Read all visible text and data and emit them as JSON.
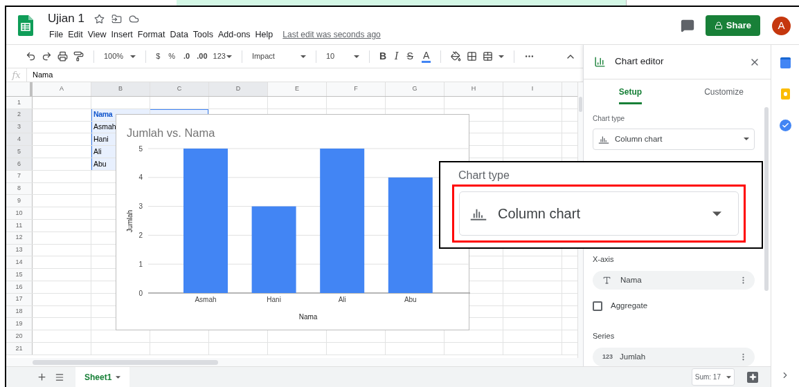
{
  "header": {
    "title": "Ujian 1",
    "menu": [
      "File",
      "Edit",
      "View",
      "Insert",
      "Format",
      "Data",
      "Tools",
      "Add-ons",
      "Help"
    ],
    "last_edit": "Last edit was seconds ago",
    "share": "Share",
    "avatar": "A"
  },
  "toolbar": {
    "zoom": "100%",
    "currency": "$",
    "percent": "%",
    "decrease_decimal": ".0",
    "increase_decimal": ".00",
    "number_format": "123",
    "font": "Impact",
    "font_size": "10",
    "bold": "B",
    "italic": "I",
    "strikethrough": "S",
    "text_color": "A"
  },
  "formula_bar": {
    "fx": "fx",
    "value": "Nama"
  },
  "grid": {
    "columns": [
      "A",
      "B",
      "C",
      "D",
      "E",
      "F",
      "G",
      "H",
      "I"
    ],
    "rows": [
      {
        "number": "1"
      },
      {
        "number": "2",
        "B": {
          "text": "Nama",
          "bold": true,
          "selected": true
        },
        "C": {
          "selected": true
        }
      },
      {
        "number": "3",
        "B": {
          "text": "Asmah",
          "bold": false,
          "selected": true
        }
      },
      {
        "number": "4",
        "B": {
          "text": "Hani",
          "bold": false,
          "selected": true
        }
      },
      {
        "number": "5",
        "B": {
          "text": "Ali",
          "bold": false,
          "selected": true
        }
      },
      {
        "number": "6",
        "B": {
          "text": "Abu",
          "bold": false,
          "selected": true
        }
      },
      {
        "number": "7"
      },
      {
        "number": "8"
      },
      {
        "number": "9"
      },
      {
        "number": "10"
      },
      {
        "number": "11"
      },
      {
        "number": "12"
      },
      {
        "number": "13"
      },
      {
        "number": "14"
      },
      {
        "number": "15"
      },
      {
        "number": "16"
      },
      {
        "number": "17"
      },
      {
        "number": "18"
      },
      {
        "number": "19"
      },
      {
        "number": "20"
      },
      {
        "number": "21"
      }
    ]
  },
  "chart": {
    "chart_data": {
      "type": "bar",
      "title": "Jumlah vs. Nama",
      "xlabel": "Nama",
      "ylabel": "Jumlah",
      "categories": [
        "Asmah",
        "Hani",
        "Ali",
        "Abu"
      ],
      "series": [
        {
          "color": "#4285f4",
          "values": [
            5,
            3,
            5,
            4
          ]
        }
      ],
      "ylim": [
        0,
        5
      ],
      "grid": true,
      "yticks": [
        {
          "value": 0,
          "label": "0"
        },
        {
          "value": 1,
          "label": "1"
        },
        {
          "value": 2,
          "label": "2"
        },
        {
          "value": 3,
          "label": "3"
        },
        {
          "value": 4,
          "label": "4"
        },
        {
          "value": 5,
          "label": "5"
        }
      ]
    }
  },
  "chart_editor": {
    "title": "Chart editor",
    "tabs": [
      {
        "label": "Setup",
        "selected": true
      },
      {
        "label": "Customize",
        "selected": false
      }
    ],
    "chart_type": {
      "label": "Chart type",
      "value": "Column chart"
    },
    "x_axis": {
      "label": "X-axis",
      "field": "Nama"
    },
    "aggregate": {
      "label": "Aggregate",
      "checked": false
    },
    "series": {
      "label": "Series",
      "type_label": "123",
      "field": "Jumlah"
    }
  },
  "callout": {
    "label": "Chart type",
    "value": "Column chart"
  },
  "bottom_bar": {
    "sheets": [
      {
        "label": "Sheet1",
        "selected": true
      }
    ],
    "sum": "Sum: 17"
  }
}
